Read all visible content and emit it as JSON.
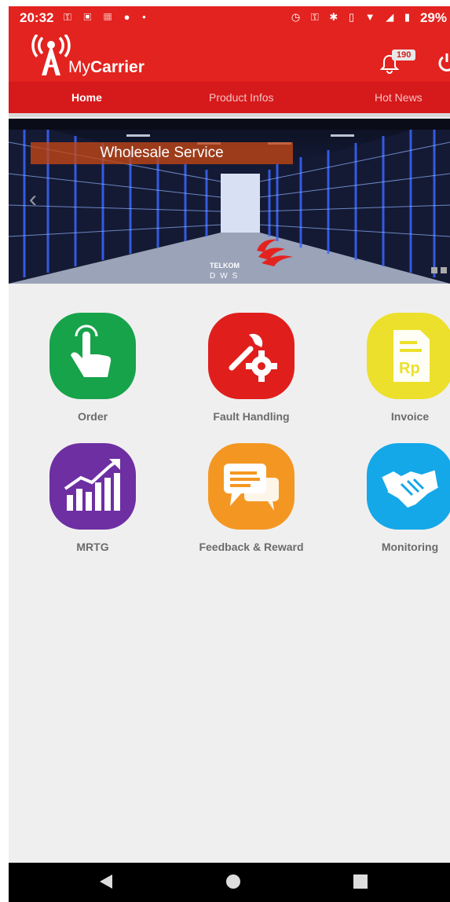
{
  "status_bar": {
    "time": "20:32",
    "left_icons": [
      "key-icon",
      "bag-icon",
      "gallery-icon",
      "line-icon",
      "dot-icon"
    ],
    "right_icons": [
      "alarm-icon",
      "key-icon",
      "bluetooth-icon",
      "vibrate-icon",
      "wifi-icon",
      "signal-icon",
      "battery-icon"
    ],
    "battery": "29%"
  },
  "header": {
    "brand_my": "My",
    "brand_carrier": "Carrier",
    "notification_count": "190"
  },
  "tabs": [
    {
      "label": "Home",
      "active": true
    },
    {
      "label": "Product Infos",
      "active": false
    },
    {
      "label": "Hot News",
      "active": false
    }
  ],
  "banner": {
    "title": "Wholesale Service",
    "company": "TELKOM"
  },
  "menu": [
    {
      "label": "Order",
      "icon": "tap-icon",
      "color": "#17a34a"
    },
    {
      "label": "Fault Handling",
      "icon": "tools-icon",
      "color": "#e01f1d"
    },
    {
      "label": "Invoice",
      "icon": "invoice-icon",
      "color": "#ece02c"
    },
    {
      "label": "MRTG",
      "icon": "growth-chart-icon",
      "color": "#6d2fa2"
    },
    {
      "label": "Feedback & Reward",
      "icon": "chat-icon",
      "color": "#f49722"
    },
    {
      "label": "Monitoring",
      "icon": "handshake-icon",
      "color": "#14a8e8"
    }
  ],
  "invoice_icon_text": "Rp",
  "colors": {
    "primary": "#e3231f",
    "tab_bar": "#d6191b",
    "background": "#f0eff0"
  }
}
